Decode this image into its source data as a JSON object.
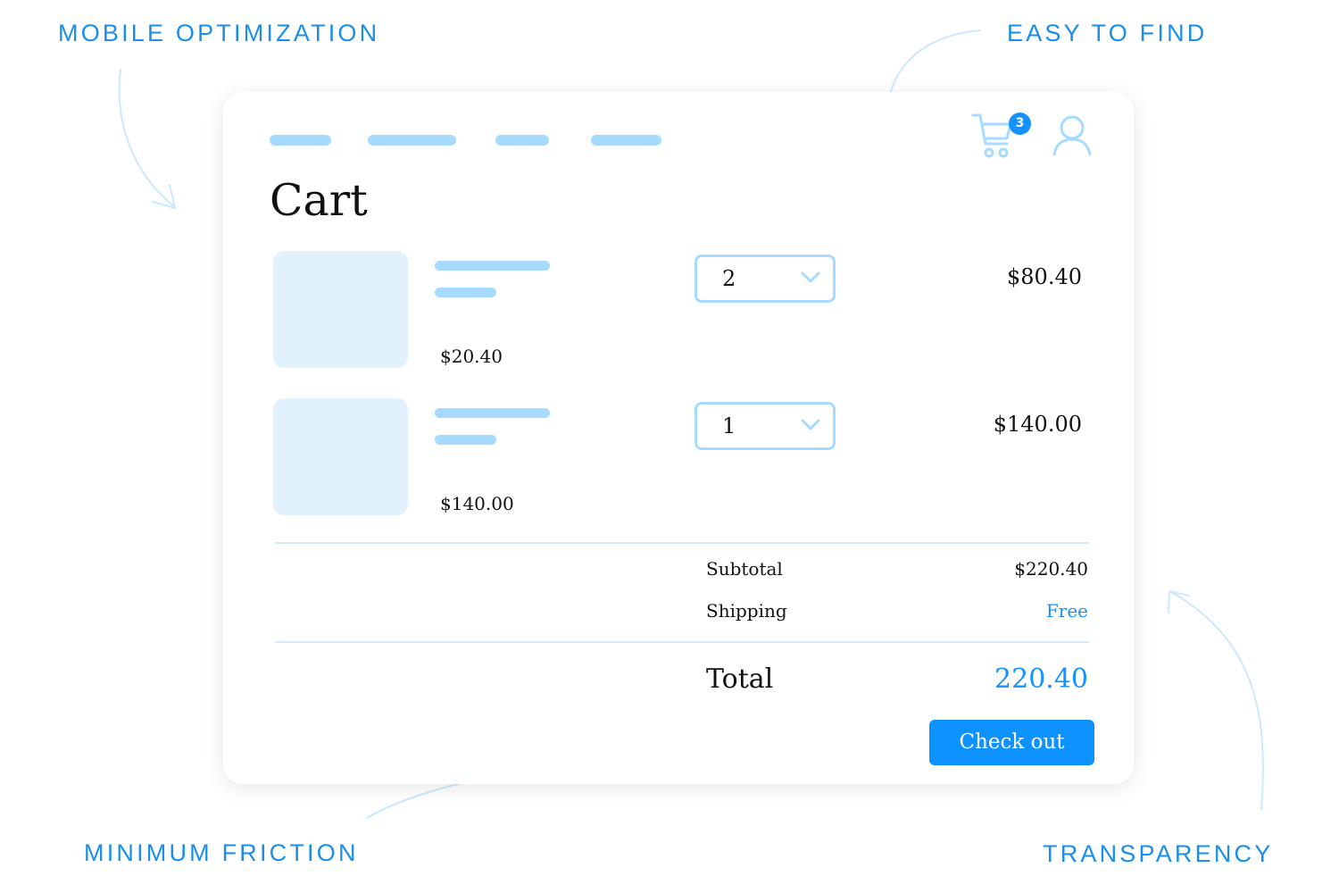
{
  "callouts": {
    "top_left": "MOBILE OPTIMIZATION",
    "top_right": "EASY TO FIND",
    "bottom_left": "MINIMUM FRICTION",
    "bottom_right": "TRANSPARENCY"
  },
  "header": {
    "nav_item_count": 4,
    "cart_badge": "3",
    "icons": [
      "shopping-cart-icon",
      "user-icon"
    ]
  },
  "page": {
    "title": "Cart"
  },
  "items": [
    {
      "unit_price": "$20.40",
      "quantity": "2",
      "line_total": "$80.40"
    },
    {
      "unit_price": "$140.00",
      "quantity": "1",
      "line_total": "$140.00"
    }
  ],
  "summary": {
    "subtotal_label": "Subtotal",
    "subtotal_value": "$220.40",
    "shipping_label": "Shipping",
    "shipping_value": "Free",
    "total_label": "Total",
    "total_value": "220.40"
  },
  "checkout": {
    "label": "Check out"
  },
  "colors": {
    "accent": "#1592ff",
    "callout_text": "#1a8ee8",
    "placeholder_bar": "#a6daff",
    "thumbnail": "#e1f2fd",
    "divider": "#d3ebf9"
  }
}
